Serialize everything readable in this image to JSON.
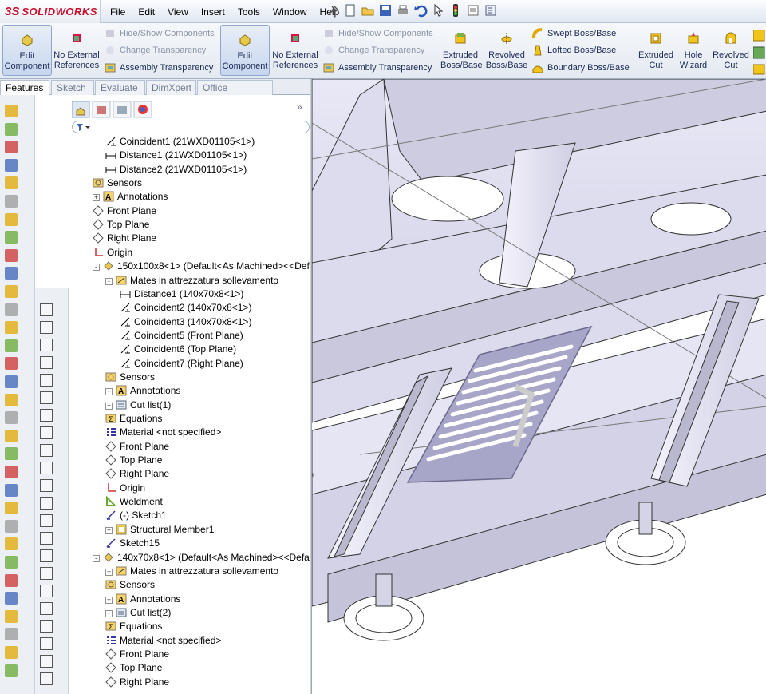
{
  "app": {
    "logo_prefix": "3S",
    "logo_name": "SOLIDWORKS"
  },
  "menu": [
    "File",
    "Edit",
    "View",
    "Insert",
    "Tools",
    "Window",
    "Help"
  ],
  "ribbon": {
    "edit_component": "Edit Component",
    "no_external_refs": "No External References",
    "hide_show": "Hide/Show Components",
    "change_transparency": "Change Transparency",
    "assembly_transparency": "Assembly Transparency",
    "extruded_boss": "Extruded Boss/Base",
    "revolved_boss": "Revolved Boss/Base",
    "swept_boss": "Swept Boss/Base",
    "lofted_boss": "Lofted Boss/Base",
    "boundary_boss": "Boundary Boss/Base",
    "extruded_cut": "Extruded Cut",
    "hole_wizard": "Hole Wizard",
    "revolved_cut": "Revolved Cut"
  },
  "tabs": [
    "Features",
    "Sketch",
    "Evaluate",
    "DimXpert",
    "Office Products"
  ],
  "tree": [
    {
      "level": 2,
      "icon": "coincident",
      "label": "Coincident1 (21WXD01105<1>)"
    },
    {
      "level": 2,
      "icon": "distance",
      "label": "Distance1 (21WXD01105<1>)"
    },
    {
      "level": 2,
      "icon": "distance",
      "label": "Distance2 (21WXD01105<1>)"
    },
    {
      "level": 1,
      "icon": "sensors",
      "label": "Sensors"
    },
    {
      "level": 1,
      "icon": "annotations",
      "label": "Annotations",
      "exp": "+"
    },
    {
      "level": 1,
      "icon": "plane",
      "label": "Front Plane"
    },
    {
      "level": 1,
      "icon": "plane",
      "label": "Top Plane"
    },
    {
      "level": 1,
      "icon": "plane",
      "label": "Right Plane"
    },
    {
      "level": 1,
      "icon": "origin",
      "label": "Origin"
    },
    {
      "level": 1,
      "icon": "part",
      "label": "150x100x8<1> (Default<As Machined><<Def",
      "exp": "-"
    },
    {
      "level": 2,
      "icon": "mates",
      "label": "Mates in attrezzatura sollevamento",
      "exp": "-"
    },
    {
      "level": 3,
      "icon": "distance",
      "label": "Distance1 (140x70x8<1>)"
    },
    {
      "level": 3,
      "icon": "coincident",
      "label": "Coincident2 (140x70x8<1>)"
    },
    {
      "level": 3,
      "icon": "coincident",
      "label": "Coincident3 (140x70x8<1>)"
    },
    {
      "level": 3,
      "icon": "coincident",
      "label": "Coincident5 (Front Plane)"
    },
    {
      "level": 3,
      "icon": "coincident",
      "label": "Coincident6 (Top Plane)"
    },
    {
      "level": 3,
      "icon": "coincident",
      "label": "Coincident7 (Right Plane)"
    },
    {
      "level": 2,
      "icon": "sensors",
      "label": "Sensors"
    },
    {
      "level": 2,
      "icon": "annotations",
      "label": "Annotations",
      "exp": "+"
    },
    {
      "level": 2,
      "icon": "cutlist",
      "label": "Cut list(1)",
      "exp": "+"
    },
    {
      "level": 2,
      "icon": "equations",
      "label": "Equations"
    },
    {
      "level": 2,
      "icon": "material",
      "label": "Material <not specified>"
    },
    {
      "level": 2,
      "icon": "plane",
      "label": "Front Plane"
    },
    {
      "level": 2,
      "icon": "plane",
      "label": "Top Plane"
    },
    {
      "level": 2,
      "icon": "plane",
      "label": "Right Plane"
    },
    {
      "level": 2,
      "icon": "origin",
      "label": "Origin"
    },
    {
      "level": 2,
      "icon": "weldment",
      "label": "Weldment"
    },
    {
      "level": 2,
      "icon": "sketch",
      "label": "(-) Sketch1"
    },
    {
      "level": 2,
      "icon": "structural",
      "label": "Structural Member1",
      "exp": "+"
    },
    {
      "level": 2,
      "icon": "sketch",
      "label": "Sketch15"
    },
    {
      "level": 1,
      "icon": "part",
      "label": "140x70x8<1> (Default<As Machined><<Defa",
      "exp": "-"
    },
    {
      "level": 2,
      "icon": "mates",
      "label": "Mates in attrezzatura sollevamento",
      "exp": "+"
    },
    {
      "level": 2,
      "icon": "sensors",
      "label": "Sensors"
    },
    {
      "level": 2,
      "icon": "annotations",
      "label": "Annotations",
      "exp": "+"
    },
    {
      "level": 2,
      "icon": "cutlist",
      "label": "Cut list(2)",
      "exp": "+"
    },
    {
      "level": 2,
      "icon": "equations",
      "label": "Equations"
    },
    {
      "level": 2,
      "icon": "material",
      "label": "Material <not specified>"
    },
    {
      "level": 2,
      "icon": "plane",
      "label": "Front Plane"
    },
    {
      "level": 2,
      "icon": "plane",
      "label": "Top Plane"
    },
    {
      "level": 2,
      "icon": "plane",
      "label": "Right Plane"
    }
  ]
}
